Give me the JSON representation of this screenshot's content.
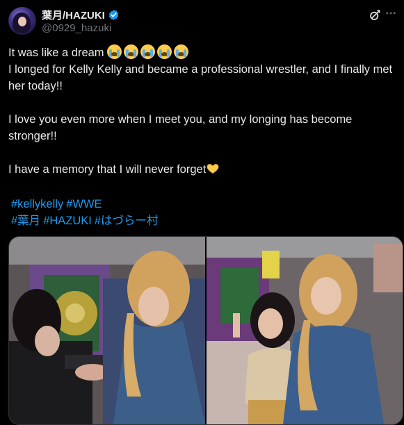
{
  "author": {
    "display_name": "葉月/HAZUKI",
    "handle": "@0929_hazuki"
  },
  "post": {
    "line1": "It was like a dream",
    "line2": "I longed for Kelly Kelly and became a professional wrestler, and I finally met her today!!",
    "line3": "I love you even more when I meet you, and my longing has become stronger!!",
    "line4": "I have a memory that I will never forget",
    "emoji_count": 5,
    "hashtags_row1": [
      "#kellykelly",
      "#WWE"
    ],
    "hashtags_row2": [
      "#葉月",
      "#HAZUKI",
      "#はづらー村"
    ]
  },
  "colors": {
    "link": "#1d9bf0",
    "verified": "#1d9bf0",
    "background": "#000000"
  },
  "icons": {
    "verified": "verified-badge-icon",
    "grok": "grok-icon",
    "more": "more-icon",
    "crying": "loudly-crying-face-emoji",
    "heart": "heart-hands-emoji"
  }
}
